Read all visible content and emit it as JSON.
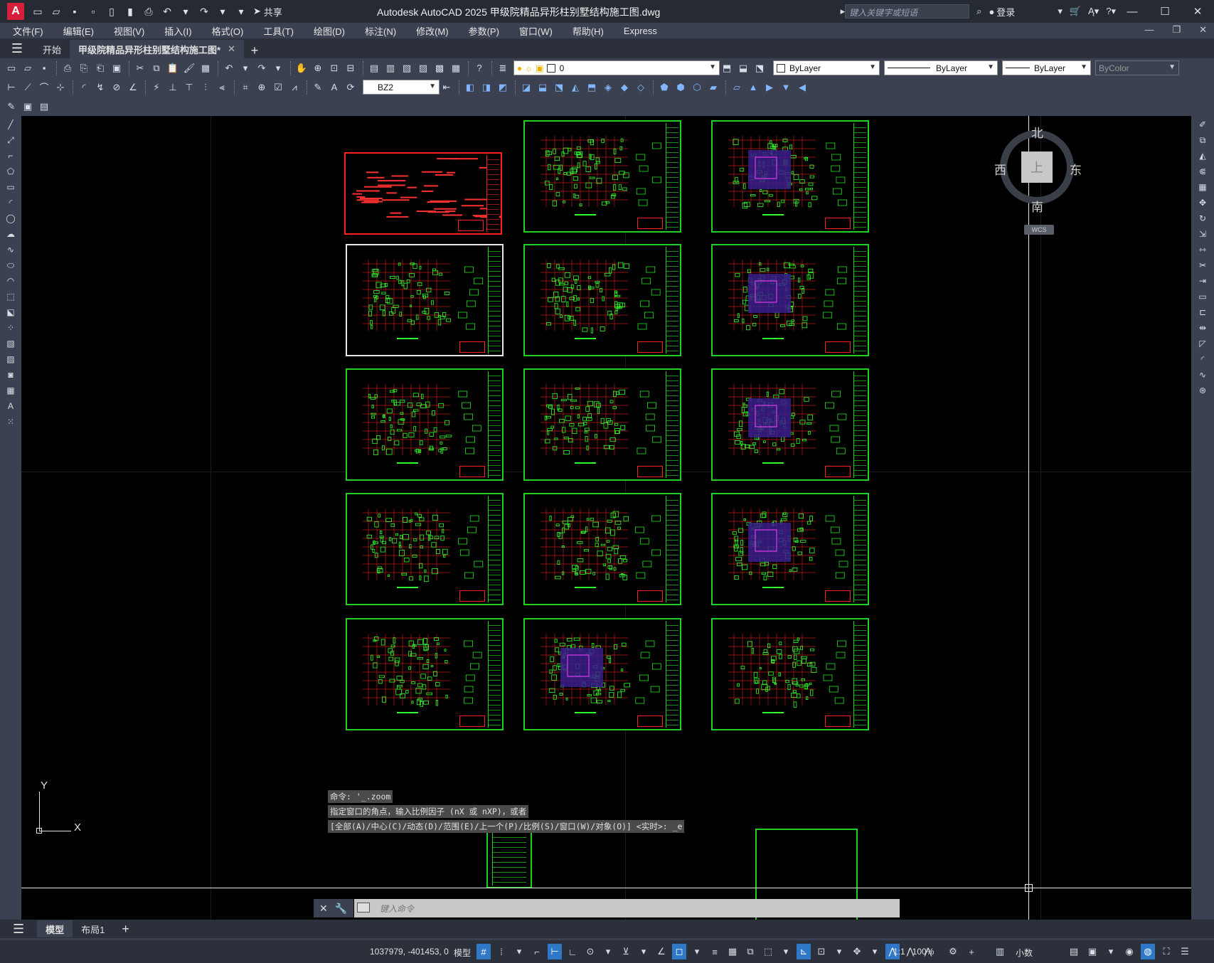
{
  "app": {
    "logo_letter": "A",
    "share_label": "共享",
    "window_title": "Autodesk AutoCAD 2025    甲级院精品异形柱别墅结构施工图.dwg",
    "search_placeholder": "键入关键字或短语",
    "login_label": "登录"
  },
  "menu": [
    "文件(F)",
    "编辑(E)",
    "视图(V)",
    "插入(I)",
    "格式(O)",
    "工具(T)",
    "绘图(D)",
    "标注(N)",
    "修改(M)",
    "参数(P)",
    "窗口(W)",
    "帮助(H)",
    "Express"
  ],
  "doc_tabs": {
    "start": "开始",
    "current": "甲级院精品异形柱别墅结构施工图*"
  },
  "toolbar": {
    "layer_value": "0",
    "color_value": "ByLayer",
    "linetype_value": "ByLayer",
    "lineweight_value": "ByLayer",
    "plotstyle_value": "ByColor",
    "dimstyle_value": "BZ2"
  },
  "viewcube": {
    "north": "北",
    "south": "南",
    "east": "东",
    "west": "西",
    "top": "上",
    "wcs": "WCS"
  },
  "ucs": {
    "x": "X",
    "y": "Y"
  },
  "command": {
    "history": [
      "命令: '_.zoom",
      "指定窗口的角点，输入比例因子 (nX 或 nXP)，或者",
      "[全部(A)/中心(C)/动态(D)/范围(E)/上一个(P)/比例(S)/窗口(W)/对象(O)] <实时>: _e"
    ],
    "input_placeholder": "键入命令"
  },
  "layout_tabs": {
    "model": "模型",
    "layout1": "布局1"
  },
  "status": {
    "coordinates": "1037979, -401453, 0",
    "model_label": "模型",
    "scale": "1:1 / 100%",
    "units": "小数"
  },
  "colors": {
    "sheet_border": "#20d020",
    "accent": "#2f78c8",
    "background": "#000000",
    "brand": "#d6203b"
  }
}
